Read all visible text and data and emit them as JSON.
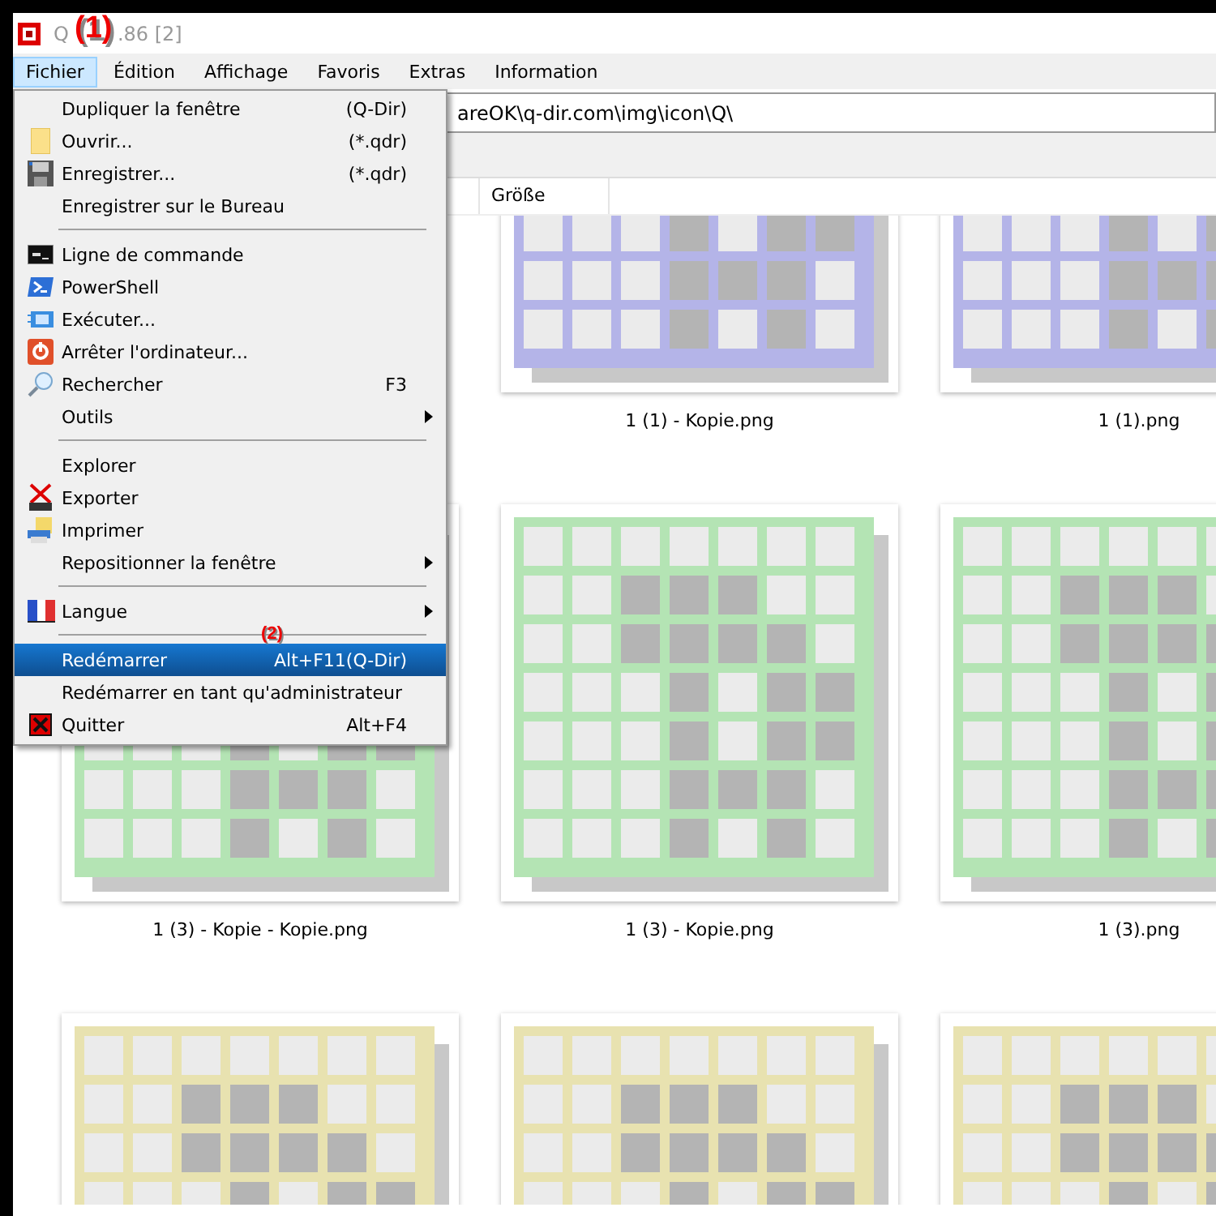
{
  "window": {
    "title_start": "Q",
    "title_end": ".86 [2]"
  },
  "annotations": [
    {
      "label": "(1)"
    },
    {
      "label": "(2)"
    }
  ],
  "menu_bar": [
    {
      "label": "Fichier",
      "selected": true
    },
    {
      "label": "Édition",
      "selected": false
    },
    {
      "label": "Affichage",
      "selected": false
    },
    {
      "label": "Favoris",
      "selected": false
    },
    {
      "label": "Extras",
      "selected": false
    },
    {
      "label": "Information",
      "selected": false
    }
  ],
  "address_bar": {
    "value": "areOK\\q-dir.com\\img\\icon\\Q\\"
  },
  "columns": [
    {
      "label": "Größe"
    }
  ],
  "menu": [
    {
      "kind": "item",
      "label": "Dupliquer la fenêtre",
      "shortcut": "(Q-Dir)",
      "submenu": false,
      "selected": false
    },
    {
      "kind": "item",
      "label": "Ouvrir...",
      "shortcut": "(*.qdr)",
      "submenu": false,
      "selected": false
    },
    {
      "kind": "item",
      "label": "Enregistrer...",
      "shortcut": "(*.qdr)",
      "submenu": false,
      "selected": false
    },
    {
      "kind": "item",
      "label": "Enregistrer sur le Bureau",
      "submenu": false,
      "selected": false
    },
    {
      "kind": "separator"
    },
    {
      "kind": "item",
      "label": "Ligne de commande",
      "submenu": false,
      "selected": false
    },
    {
      "kind": "item",
      "label": "PowerShell",
      "submenu": false,
      "selected": false
    },
    {
      "kind": "item",
      "label": "Exécuter...",
      "submenu": false,
      "selected": false
    },
    {
      "kind": "item",
      "label": "Arrêter l'ordinateur...",
      "submenu": false,
      "selected": false
    },
    {
      "kind": "item",
      "label": "Rechercher",
      "shortcut": "F3",
      "submenu": false,
      "selected": false
    },
    {
      "kind": "item",
      "label": "Outils",
      "submenu": true,
      "selected": false
    },
    {
      "kind": "separator"
    },
    {
      "kind": "item",
      "label": "Explorer",
      "submenu": false,
      "selected": false
    },
    {
      "kind": "item",
      "label": "Exporter",
      "submenu": false,
      "selected": false
    },
    {
      "kind": "item",
      "label": "Imprimer",
      "submenu": false,
      "selected": false
    },
    {
      "kind": "item",
      "label": "Repositionner la fenêtre",
      "submenu": true,
      "selected": false
    },
    {
      "kind": "separator"
    },
    {
      "kind": "item",
      "label": "Langue",
      "submenu": true,
      "selected": false
    },
    {
      "kind": "separator"
    },
    {
      "kind": "item",
      "label": "Redémarrer",
      "shortcut": "Alt+F11(Q-Dir)",
      "submenu": false,
      "selected": true
    },
    {
      "kind": "item",
      "label": "Redémarrer en tant qu'administrateur",
      "submenu": false,
      "selected": false
    },
    {
      "kind": "item",
      "label": "Quitter",
      "shortcut": "Alt+F4",
      "submenu": false,
      "selected": false
    }
  ],
  "files": [
    {
      "name": "1 (1) - Kopie.png",
      "color": "#b4b4e8"
    },
    {
      "name": "1 (1).png",
      "color": "#b4b4e8"
    },
    {
      "name": "1 (3) - Kopie - Kopie.png",
      "color": "#b4e4b4"
    },
    {
      "name": "1 (3) - Kopie.png",
      "color": "#b4e4b4"
    },
    {
      "name": "1 (3).png",
      "color": "#b4e4b4"
    },
    {
      "color": "#e8e2b0"
    },
    {
      "color": "#e8e2b0"
    },
    {
      "color": "#e8e2b0"
    }
  ]
}
